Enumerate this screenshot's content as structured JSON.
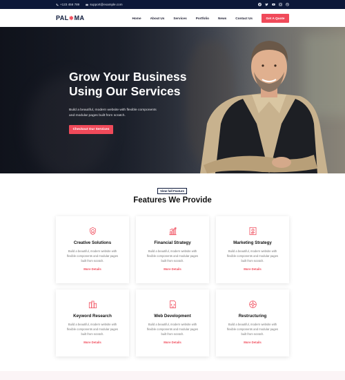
{
  "topbar": {
    "phone": "+123 456 789",
    "email": "support@example.com",
    "social_icons": [
      "facebook-icon",
      "twitter-icon",
      "youtube-icon",
      "instagram-icon",
      "dribbble-icon"
    ]
  },
  "nav": {
    "logo_left": "PAL",
    "logo_right": "MA",
    "items": [
      "Home",
      "About Us",
      "Services",
      "Portfolio",
      "News",
      "Contact Us"
    ],
    "cta": "Get A Quote"
  },
  "hero": {
    "title": "Grow Your Business Using Our Services",
    "subtitle": "Build a beautiful, modern website with flexible components and modular pages built from scratch.",
    "button": "Checkout Our Services"
  },
  "features": {
    "badge": "View full Feature",
    "title": "Features We Provide",
    "cards": [
      {
        "title": "Creative Solutions",
        "desc": "Build a beautiful, modern website with flexible components and modular pages built from scratch.",
        "link": "More Details",
        "icon": "award-icon"
      },
      {
        "title": "Financial Strategy",
        "desc": "Build a beautiful, modern website with flexible components and modular pages built from scratch.",
        "link": "More Details",
        "icon": "bar-chart-icon"
      },
      {
        "title": "Marketing Strategy",
        "desc": "Build a beautiful, modern website with flexible components and modular pages built from scratch.",
        "link": "More Details",
        "icon": "strategy-document-icon"
      },
      {
        "title": "Keyword Research",
        "desc": "Build a beautiful, modern website with flexible components and modular pages built from scratch.",
        "link": "More Details",
        "icon": "keyword-icon"
      },
      {
        "title": "Web Development",
        "desc": "Build a beautiful, modern website with flexible components and modular pages built from scratch.",
        "link": "More Details",
        "icon": "code-document-icon"
      },
      {
        "title": "Restructuring",
        "desc": "Build a beautiful, modern website with flexible components and modular pages built from scratch.",
        "link": "More Details",
        "icon": "restructure-icon"
      }
    ]
  },
  "colors": {
    "accent": "#f04a5a",
    "navy": "#0c1839"
  }
}
